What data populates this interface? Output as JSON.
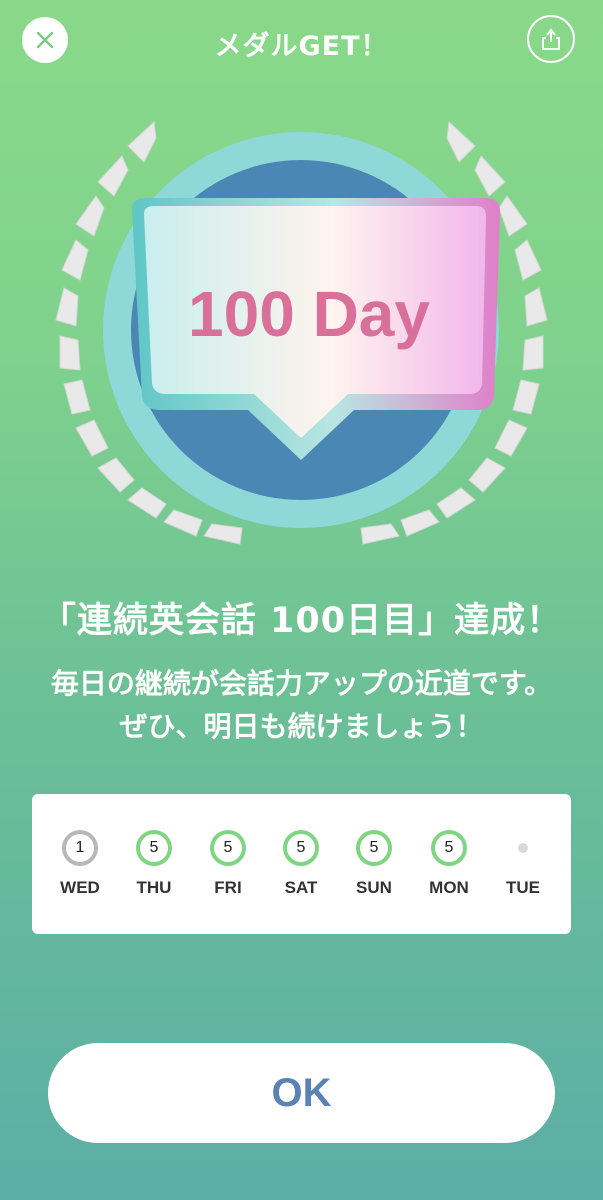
{
  "header": {
    "title": "メダルGET！",
    "close_icon": "close-icon",
    "share_icon": "share-icon"
  },
  "medal": {
    "label": "100 Day",
    "colors": {
      "ring": "#8fd8d8",
      "inner": "#4a87b4",
      "laurel": "#e9e9e9",
      "text": "#d8709a"
    }
  },
  "achievement": {
    "title": "「連続英会話 100日目」達成！",
    "message_line1": "毎日の継続が会話力アップの近道です。",
    "message_line2": "ぜひ、明日も続けましょう！"
  },
  "streak": {
    "days": [
      {
        "label": "WED",
        "count": "1",
        "state": "gray"
      },
      {
        "label": "THU",
        "count": "5",
        "state": "done"
      },
      {
        "label": "FRI",
        "count": "5",
        "state": "done"
      },
      {
        "label": "SAT",
        "count": "5",
        "state": "done"
      },
      {
        "label": "SUN",
        "count": "5",
        "state": "done"
      },
      {
        "label": "MON",
        "count": "5",
        "state": "done"
      },
      {
        "label": "TUE",
        "count": "",
        "state": "empty"
      }
    ]
  },
  "actions": {
    "ok_label": "OK"
  },
  "colors": {
    "background_top": "#8ad98a",
    "background_bottom": "#5caea6",
    "done_ring": "#7fd682",
    "pending_ring": "#b8b8b8",
    "ok_text": "#5a82b4"
  }
}
